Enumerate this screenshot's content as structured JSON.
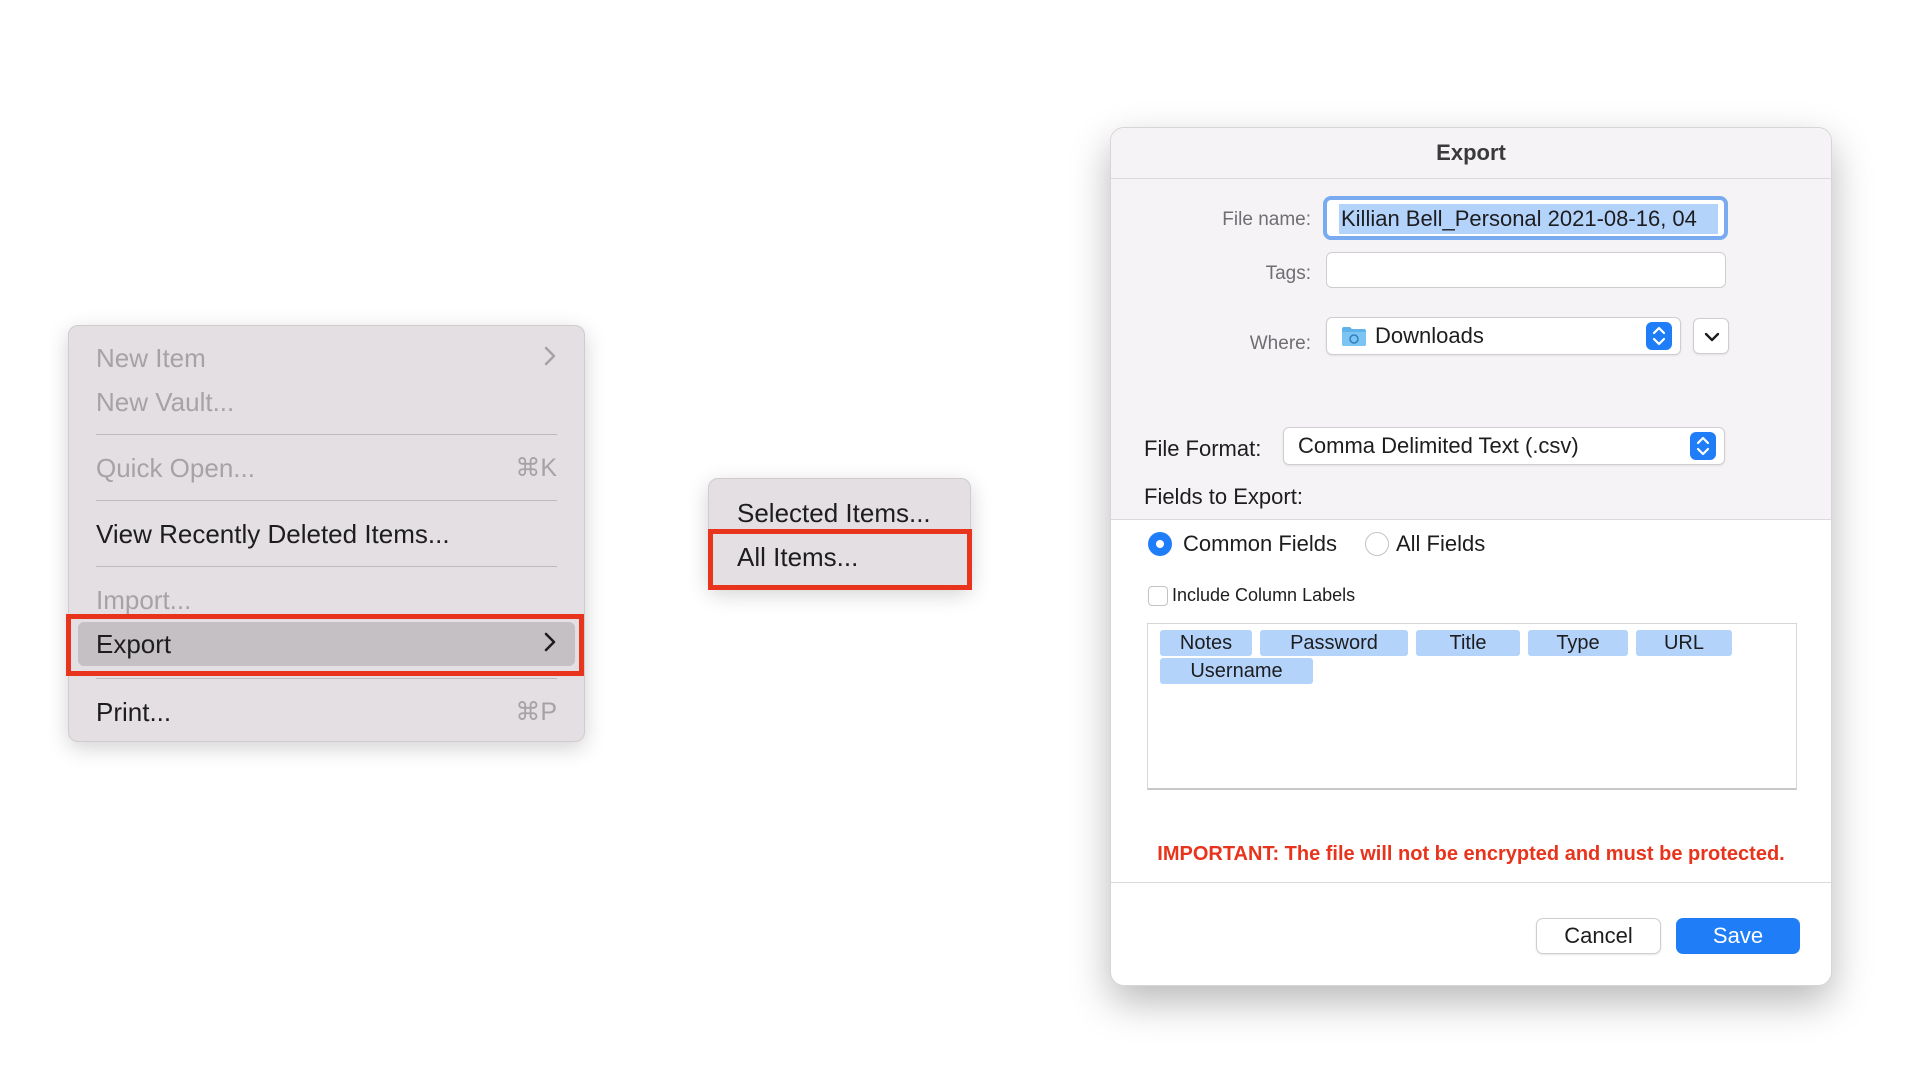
{
  "file_menu": {
    "items": [
      {
        "label": "New Item",
        "shortcut": "",
        "submenu": true,
        "enabled": false
      },
      {
        "label": "New Vault...",
        "shortcut": "",
        "submenu": false,
        "enabled": false
      },
      {
        "label": "Quick Open...",
        "shortcut": "⌘K",
        "submenu": false,
        "enabled": false
      },
      {
        "label": "View Recently Deleted Items...",
        "shortcut": "",
        "submenu": false,
        "enabled": true
      },
      {
        "label": "Import...",
        "shortcut": "",
        "submenu": false,
        "enabled": false
      },
      {
        "label": "Export",
        "shortcut": "",
        "submenu": true,
        "enabled": true,
        "highlighted": true
      },
      {
        "label": "Print...",
        "shortcut": "⌘P",
        "submenu": false,
        "enabled": true
      }
    ]
  },
  "export_submenu": {
    "items": [
      {
        "label": "Selected Items..."
      },
      {
        "label": "All Items...",
        "highlighted_callout": true
      }
    ]
  },
  "export_dialog": {
    "title": "Export",
    "file_name_label": "File name:",
    "file_name_value": "Killian Bell_Personal 2021-08-16, 04",
    "tags_label": "Tags:",
    "tags_value": "",
    "where_label": "Where:",
    "where_value": "Downloads",
    "file_format_label": "File Format:",
    "file_format_value": "Comma Delimited Text (.csv)",
    "fields_to_export_label": "Fields to Export:",
    "radio_common": "Common Fields",
    "radio_all": "All Fields",
    "radio_selected": "Common Fields",
    "include_column_labels": "Include Column Labels",
    "include_column_labels_checked": false,
    "fields": [
      "Notes",
      "Password",
      "Title",
      "Type",
      "URL",
      "Username"
    ],
    "warning": "IMPORTANT: The file will not be encrypted and must be protected.",
    "cancel_label": "Cancel",
    "save_label": "Save"
  },
  "colors": {
    "accent": "#1f7df8",
    "callout_red": "#e8341c",
    "menu_bg": "#e3dfe2",
    "token_bg": "#b4d3fb"
  },
  "icons": {
    "submenu": "chevron-right-icon",
    "folder": "folder-icon",
    "popup": "updown-stepper-icon",
    "expand": "chevron-down-icon"
  }
}
